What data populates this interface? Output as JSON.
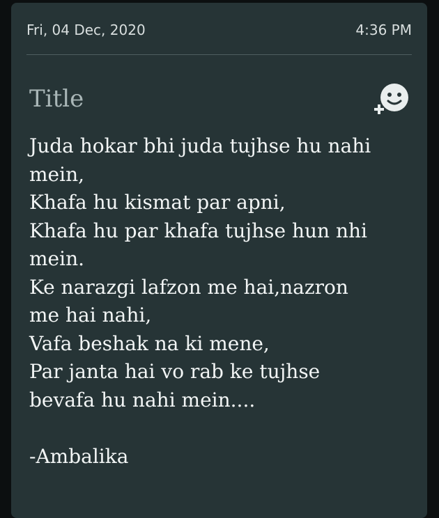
{
  "header": {
    "date": "Fri, 04 Dec, 2020",
    "time": "4:36 PM"
  },
  "note": {
    "title": "Title",
    "lines": [
      "Juda hokar bhi juda tujhse hu nahi",
      "mein,",
      "Khafa hu kismat par apni,",
      "Khafa hu par khafa tujhse hun nhi",
      "mein.",
      "Ke narazgi lafzon me hai,nazron",
      "me hai nahi,",
      "Vafa beshak na ki mene,",
      "Par janta hai vo rab ke tujhse",
      "bevafa hu nahi mein....",
      "",
      "-Ambalika"
    ]
  },
  "icons": {
    "emoji_add": "add-emoji-icon"
  },
  "colors": {
    "background": "#0c0f10",
    "card": "#263436",
    "text": "#f2f5f5",
    "muted": "#a9b6b7"
  }
}
